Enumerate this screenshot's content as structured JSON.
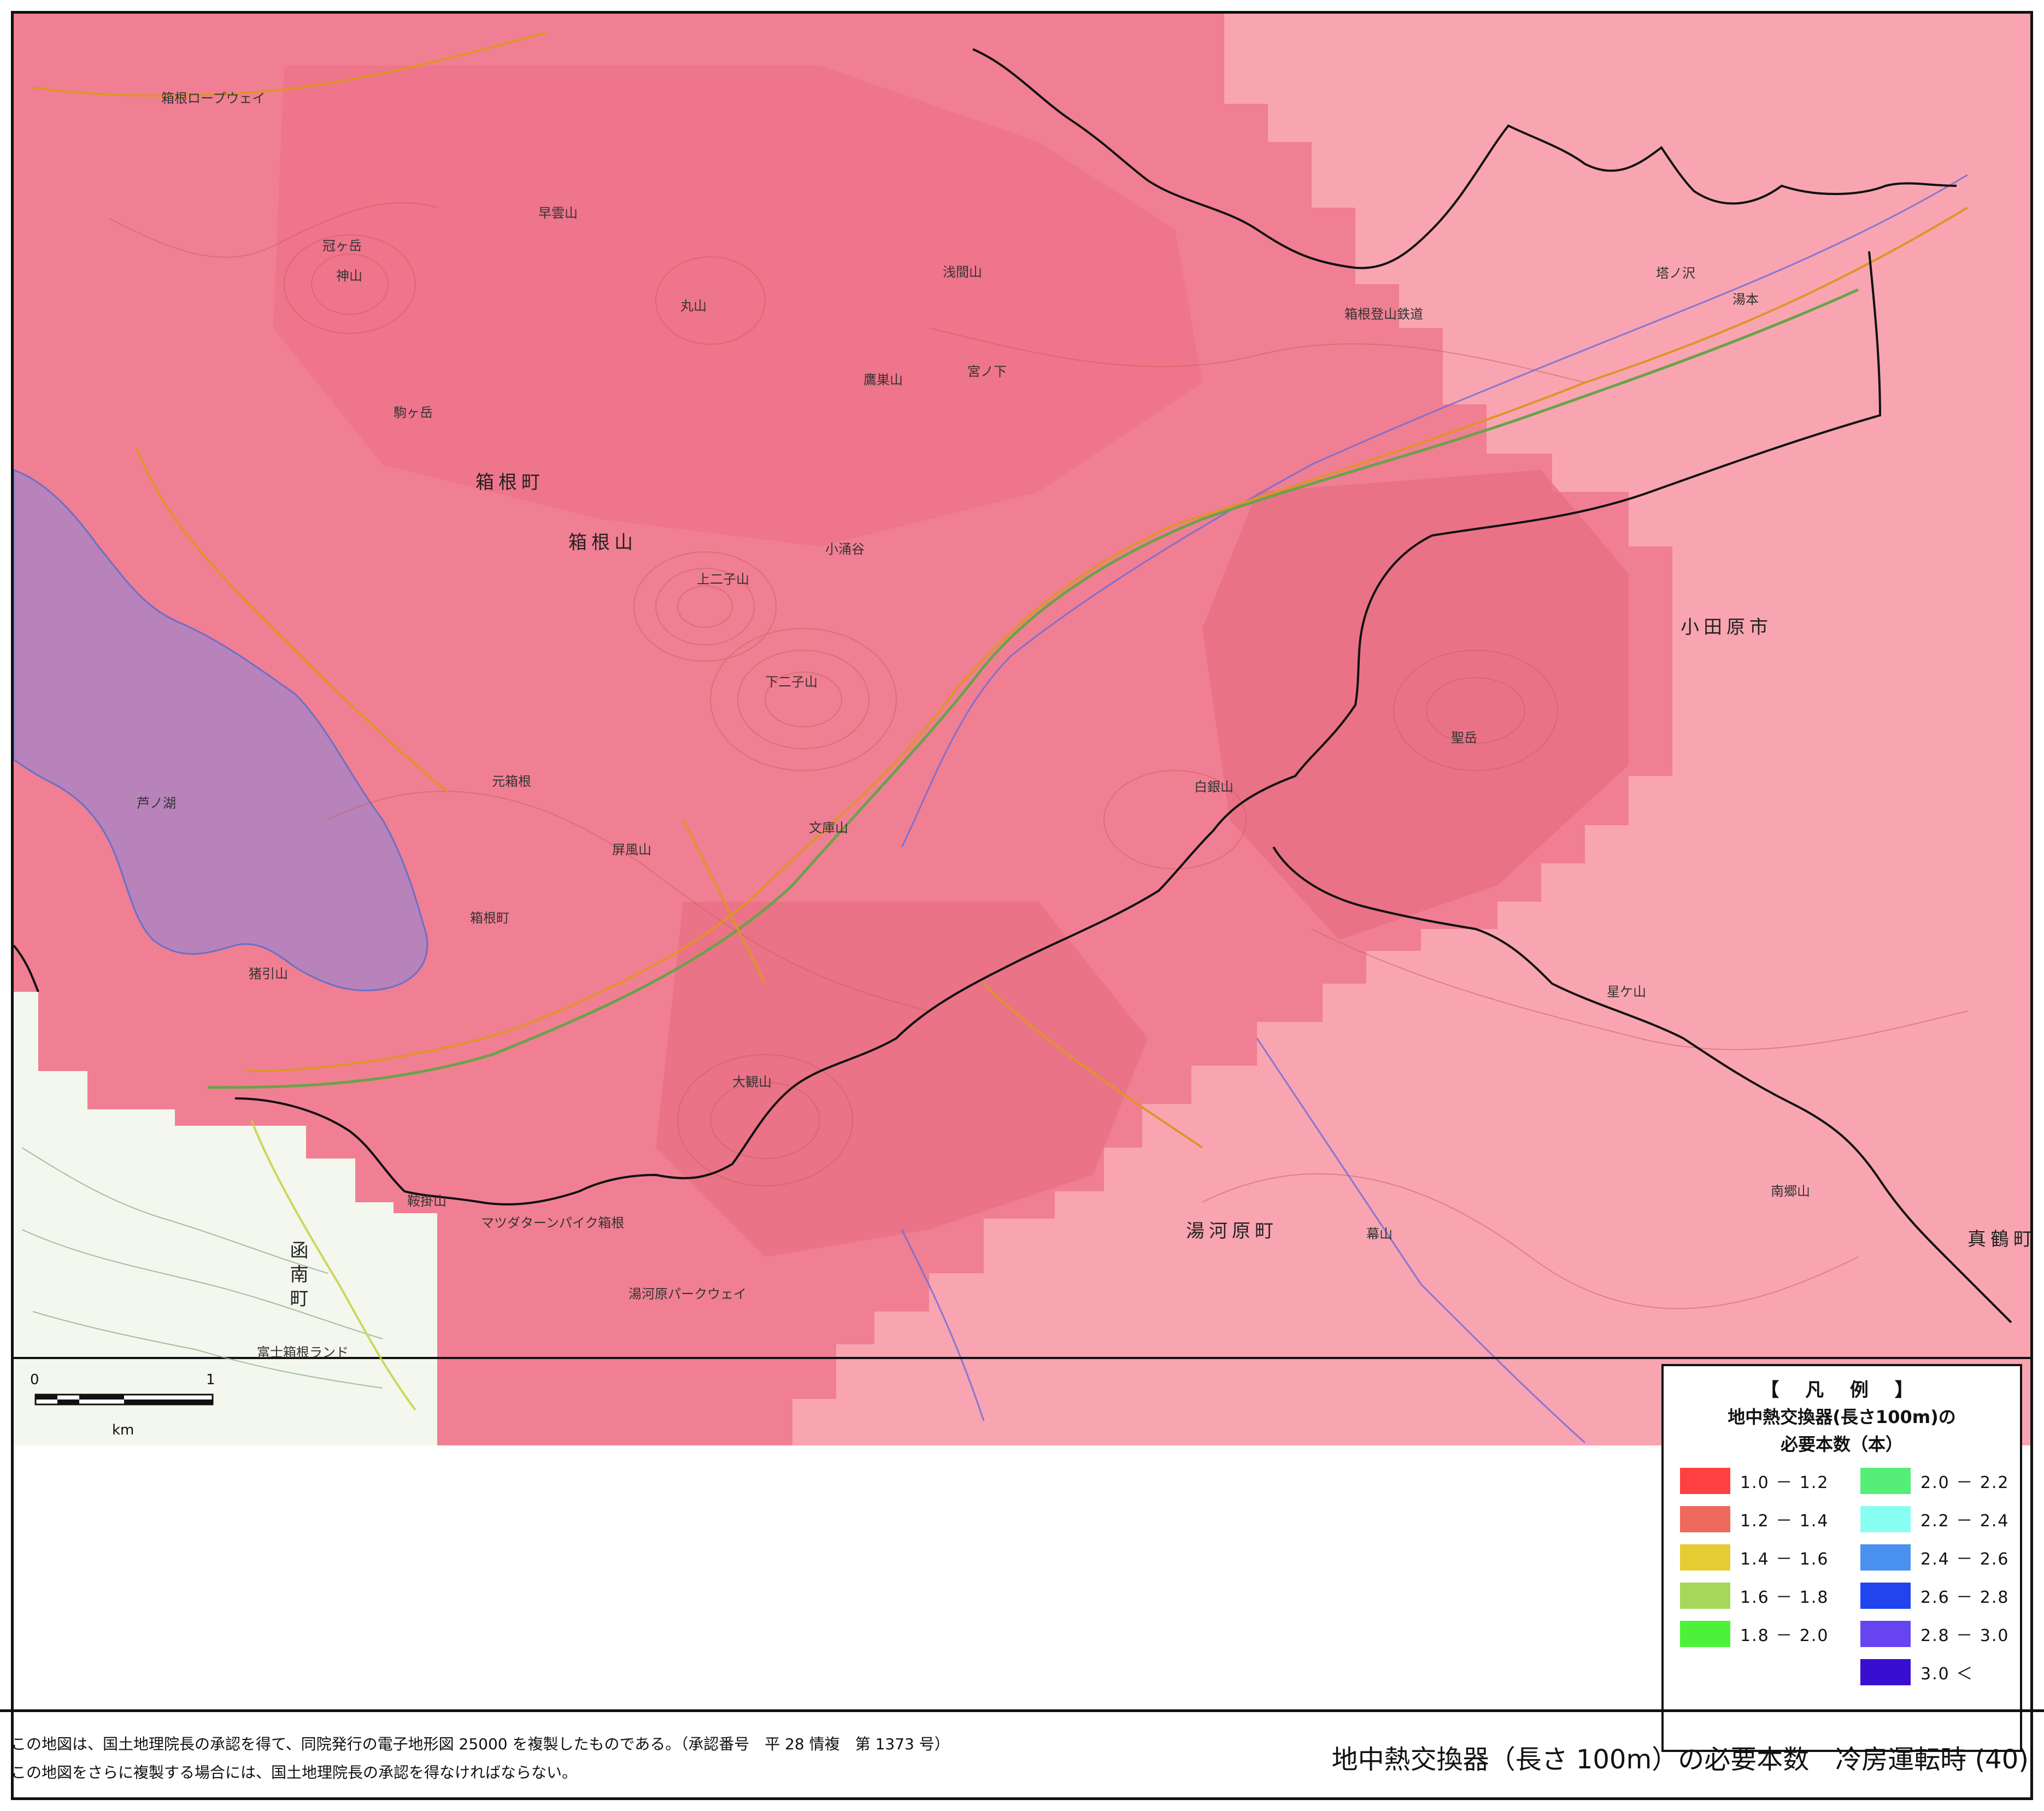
{
  "map": {
    "municipalities": [
      "箱根町",
      "小田原市",
      "湯河原町",
      "函南町",
      "真鶴町"
    ],
    "mountain_label": "箱根山",
    "peaks": [
      "冠ヶ岳",
      "神山",
      "早雲山",
      "丸山",
      "浅間山",
      "鷹巣山",
      "駒ヶ岳",
      "上二子山",
      "下二子山",
      "屏風山",
      "文庫山",
      "白銀山",
      "聖岳",
      "大観山",
      "幕山",
      "南郷山",
      "星ケ山",
      "鞍掛山",
      "猪引山"
    ],
    "features": [
      "箱根ロープウェイ",
      "箱根登山鉄道",
      "芦ノ湖",
      "箱根町",
      "元箱根",
      "宮ノ下",
      "小涌谷",
      "塔ノ沢",
      "湯本",
      "富士箱根ランド",
      "マツダターンパイク箱根",
      "湯河原パークウェイ"
    ],
    "colors": {
      "dominant": "#f07f93",
      "lake": "#b882ba",
      "light": "#f8a5b1"
    }
  },
  "scale": {
    "zero": "0",
    "one": "1",
    "unit": "km"
  },
  "legend": {
    "title": "【 凡 例 】",
    "subtitle_line1": "地中熱交換器(長さ100m)の",
    "subtitle_line2": "必要本数（本）",
    "items": [
      {
        "label": "1.0 － 1.2",
        "color": "#ff4040"
      },
      {
        "label": "1.2 － 1.4",
        "color": "#ee6a5c"
      },
      {
        "label": "1.4 － 1.6",
        "color": "#e6cc33"
      },
      {
        "label": "1.6 － 1.8",
        "color": "#a6d65a"
      },
      {
        "label": "1.8 － 2.0",
        "color": "#4cf23a"
      },
      {
        "label": "2.0 － 2.2",
        "color": "#55ee77"
      },
      {
        "label": "2.2 － 2.4",
        "color": "#88fff2"
      },
      {
        "label": "2.4 － 2.6",
        "color": "#4a90ee"
      },
      {
        "label": "2.6 － 2.8",
        "color": "#2244ee"
      },
      {
        "label": "2.8 － 3.0",
        "color": "#6644f0"
      },
      {
        "label": "3.0 ＜",
        "color": "#3a0ed0"
      }
    ]
  },
  "footer": {
    "note1": "この地図は、国土地理院長の承認を得て、同院発行の電子地形図 25000 を複製したものである。（承認番号　平 28 情複　第 1373 号）",
    "note2": "この地図をさらに複製する場合には、国土地理院長の承認を得なければならない。",
    "caption": "地中熱交換器（長さ 100m）の必要本数　冷房運転時 (40)"
  }
}
